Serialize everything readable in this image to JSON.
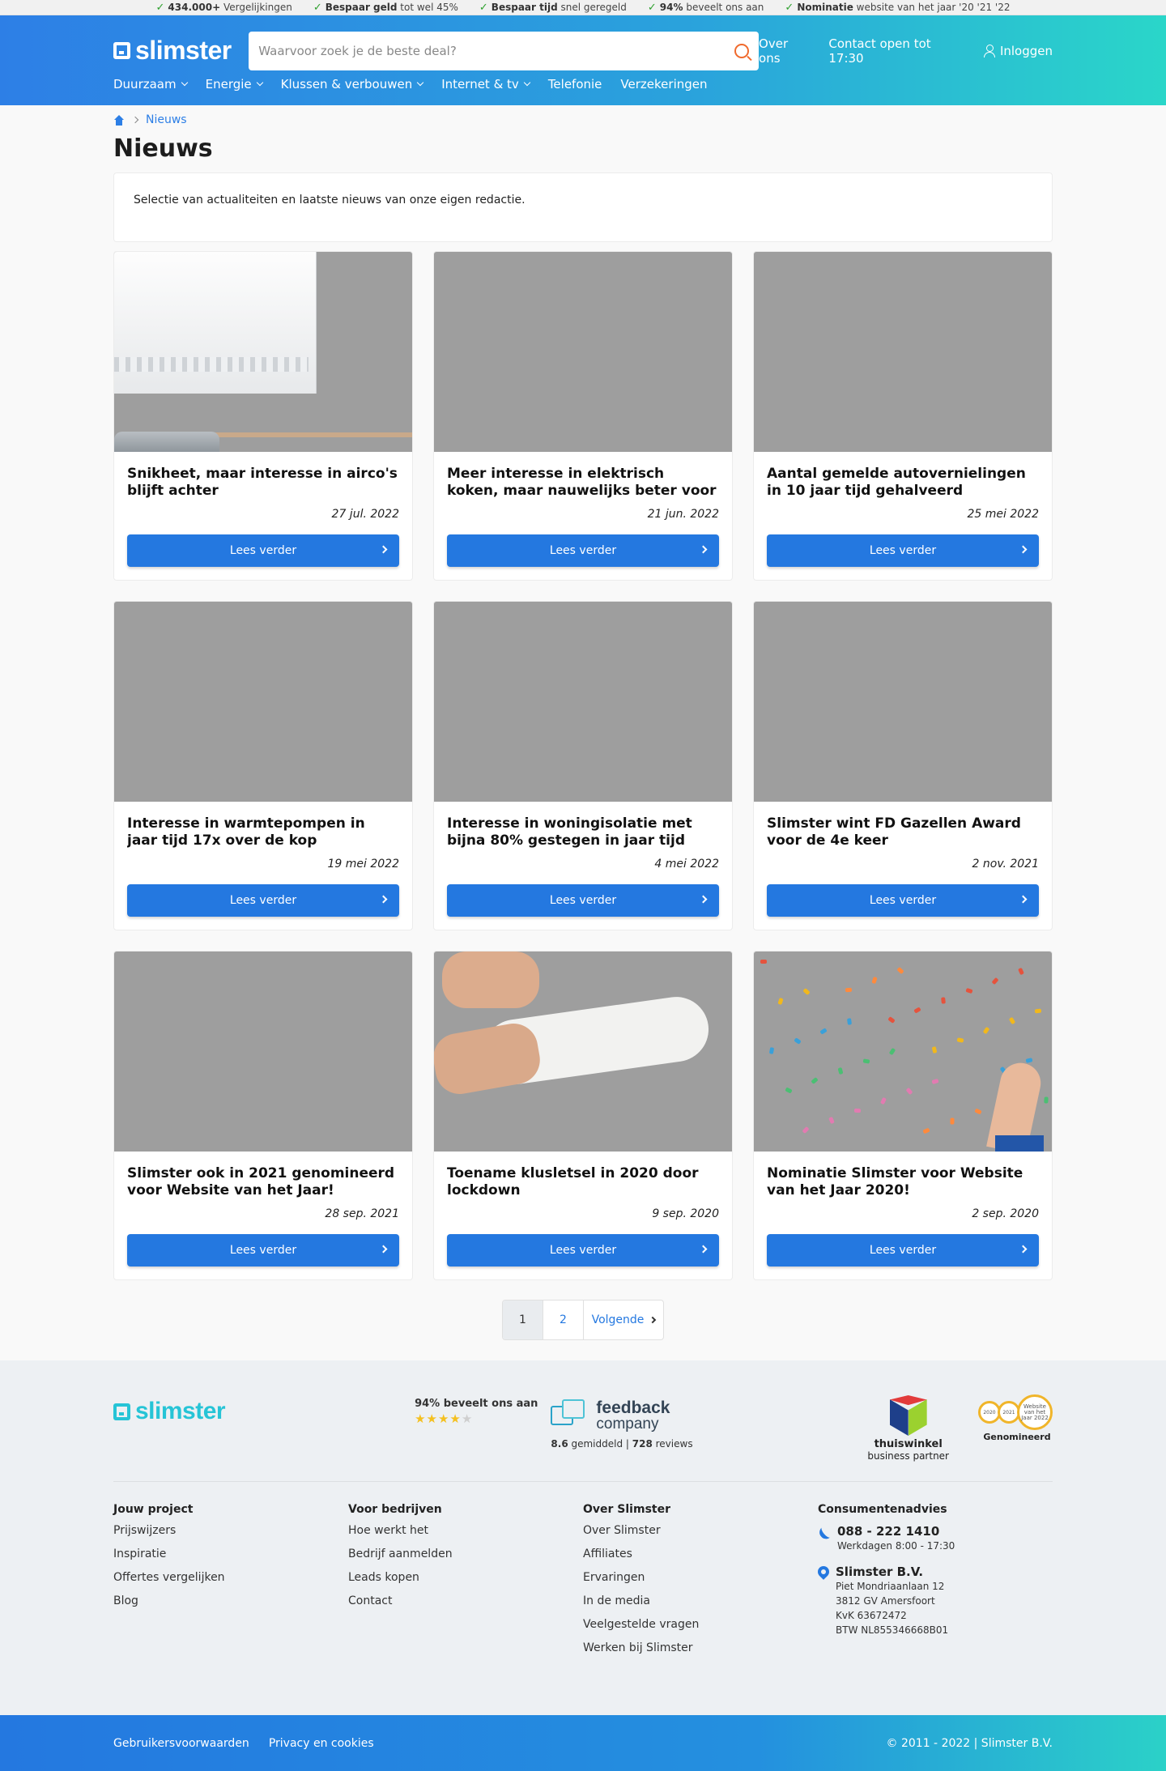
{
  "usp": [
    {
      "bold": "434.000+",
      "text": " Vergelijkingen"
    },
    {
      "bold": "Bespaar geld",
      "text": " tot wel 45%"
    },
    {
      "bold": "Bespaar tijd",
      "text": " snel geregeld"
    },
    {
      "bold": "94%",
      "text": " beveelt ons aan"
    },
    {
      "bold": "Nominatie",
      "text": " website van het jaar '20 '21 '22"
    }
  ],
  "header": {
    "logo": "slimster",
    "search_placeholder": "Waarvoor zoek je de beste deal?",
    "links": {
      "about": "Over ons",
      "contact": "Contact open tot 17:30",
      "login": "Inloggen"
    },
    "nav": [
      {
        "label": "Duurzaam",
        "dropdown": true
      },
      {
        "label": "Energie",
        "dropdown": true
      },
      {
        "label": "Klussen & verbouwen",
        "dropdown": true
      },
      {
        "label": "Internet & tv",
        "dropdown": true
      },
      {
        "label": "Telefonie",
        "dropdown": false
      },
      {
        "label": "Verzekeringen",
        "dropdown": false
      }
    ]
  },
  "breadcrumb": {
    "current": "Nieuws"
  },
  "page": {
    "title": "Nieuws",
    "intro": "Selectie van actualiteiten en laatste nieuws van onze eigen redactie.",
    "read_more": "Lees verder"
  },
  "articles": [
    {
      "title": "Snikheet, maar interesse in airco's blijft achter",
      "date": "27 jul. 2022",
      "image": "aircon"
    },
    {
      "title": "Meer interesse in elektrisch koken, maar nauwelijks beter voor portemon-…",
      "date": "21 jun. 2022",
      "image": "placeholder"
    },
    {
      "title": "Aantal gemelde autovernielingen in 10 jaar tijd gehalveerd",
      "date": "25 mei 2022",
      "image": "placeholder"
    },
    {
      "title": "Interesse in warmtepompen in jaar tijd 17x over de kop",
      "date": "19 mei 2022",
      "image": "placeholder"
    },
    {
      "title": "Interesse in woningisolatie met bijna 80% gestegen in jaar tijd",
      "date": "4 mei 2022",
      "image": "placeholder"
    },
    {
      "title": "Slimster wint FD Gazellen Award voor de 4e keer",
      "date": "2 nov. 2021",
      "image": "placeholder"
    },
    {
      "title": "Slimster ook in 2021 genomineerd voor Website van het Jaar!",
      "date": "28 sep. 2021",
      "image": "placeholder"
    },
    {
      "title": "Toename klusletsel in 2020 door lockdown",
      "date": "9 sep. 2020",
      "image": "bandage"
    },
    {
      "title": "Nominatie Slimster voor Website van het Jaar 2020!",
      "date": "2 sep. 2020",
      "image": "confetti"
    }
  ],
  "pagination": {
    "pages": [
      "1",
      "2"
    ],
    "current": "1",
    "next": "Volgende"
  },
  "footer": {
    "logo": "slimster",
    "feedback": {
      "recommend": "94% beveelt ons aan",
      "rating": 4.5,
      "brand1": "feedback",
      "brand2": "company",
      "avg": "8.6",
      "avg_text": " gemiddeld | ",
      "reviews": "728",
      "reviews_text": " reviews"
    },
    "thuiswinkel": {
      "line1": "thuiswinkel",
      "line2": "business partner"
    },
    "awards": {
      "years": [
        "2020",
        "2021"
      ],
      "big": "Website van het Jaar 2022",
      "label": "Genomineerd"
    },
    "columns": [
      {
        "title": "Jouw project",
        "links": [
          "Prijswijzers",
          "Inspiratie",
          "Offertes vergelijken",
          "Blog"
        ]
      },
      {
        "title": "Voor bedrijven",
        "links": [
          "Hoe werkt het",
          "Bedrijf aanmelden",
          "Leads kopen",
          "Contact"
        ]
      },
      {
        "title": "Over Slimster",
        "links": [
          "Over Slimster",
          "Affiliates",
          "Ervaringen",
          "In de media",
          "Veelgestelde vragen",
          "Werken bij Slimster"
        ]
      }
    ],
    "contact": {
      "title": "Consumentenadvies",
      "phone": "088 - 222 1410",
      "hours": "Werkdagen 8:00 - 17:30",
      "company": "Slimster B.V.",
      "address": [
        "Piet Mondriaanlaan 12",
        "3812 GV Amersfoort",
        "KvK 63672472",
        "BTW NL855346668B01"
      ]
    },
    "bottom": {
      "terms": "Gebruikersvoorwaarden",
      "privacy": "Privacy en cookies",
      "copyright": "© 2011 - 2022 | Slimster B.V."
    }
  }
}
